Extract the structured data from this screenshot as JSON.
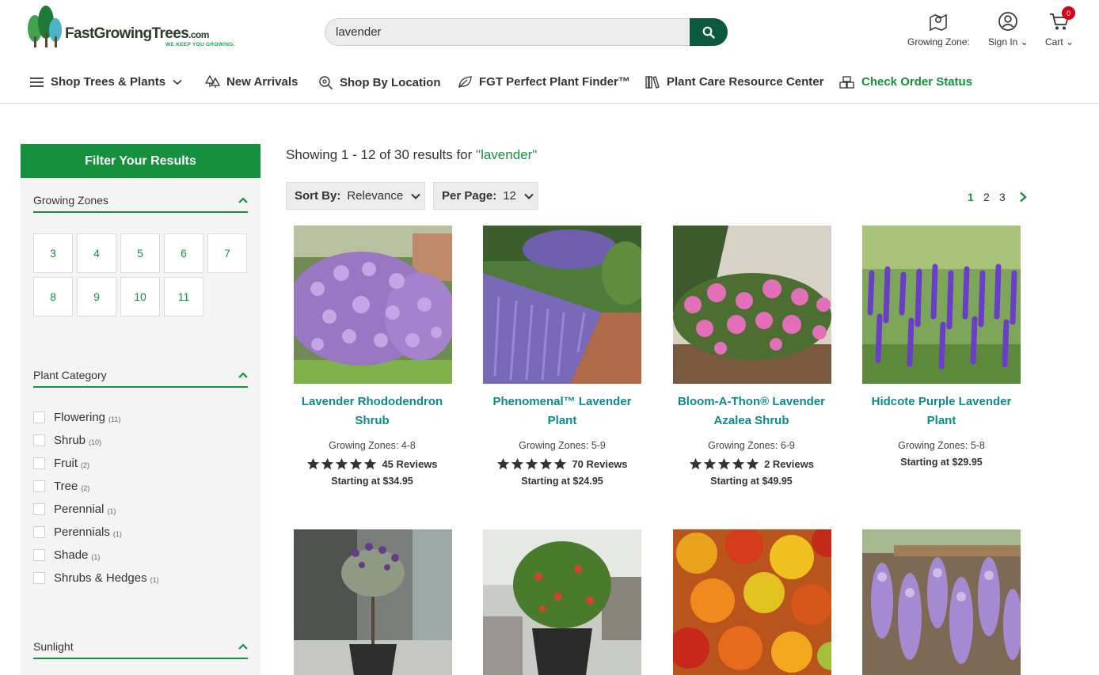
{
  "brand": {
    "name": "FastGrowingTrees",
    "suffix": ".com",
    "tagline": "WE KEEP YOU GROWING."
  },
  "search": {
    "value": "lavender",
    "placeholder": ""
  },
  "header": {
    "growing_zone_label": "Growing Zone:",
    "sign_in_label": "Sign In ⌄",
    "cart_label": "Cart ⌄",
    "cart_count": "0"
  },
  "nav": {
    "shop_trees": "Shop Trees & Plants",
    "new_arrivals": "New Arrivals",
    "shop_by_location": "Shop By Location",
    "plant_finder": "FGT Perfect Plant Finder™",
    "plant_care": "Plant Care Resource Center",
    "check_order": "Check Order Status"
  },
  "filters": {
    "heading": "Filter Your Results",
    "growing_zones": {
      "title": "Growing Zones",
      "zones": [
        "3",
        "4",
        "5",
        "6",
        "7",
        "8",
        "9",
        "10",
        "11"
      ]
    },
    "plant_category": {
      "title": "Plant Category",
      "items": [
        {
          "label": "Flowering",
          "count": "(11)"
        },
        {
          "label": "Shrub",
          "count": "(10)"
        },
        {
          "label": "Fruit",
          "count": "(2)"
        },
        {
          "label": "Tree",
          "count": "(2)"
        },
        {
          "label": "Perennial",
          "count": "(1)"
        },
        {
          "label": "Perennials",
          "count": "(1)"
        },
        {
          "label": "Shade",
          "count": "(1)"
        },
        {
          "label": "Shrubs & Hedges",
          "count": "(1)"
        }
      ]
    },
    "sunlight": {
      "title": "Sunlight"
    }
  },
  "results": {
    "prefix": "Showing 1 - 12 of 30 results for ",
    "term": "\"lavender\"",
    "sort_label": "Sort By:",
    "sort_value": "Relevance",
    "per_page_label": "Per Page:",
    "per_page_value": "12",
    "pages": [
      "1",
      "2",
      "3"
    ],
    "current_page": "1"
  },
  "products": [
    {
      "name_line1": "Lavender Rhododendron",
      "name_line2": "Shrub",
      "zones": "Growing Zones: 4-8",
      "reviews": "45 Reviews",
      "price": "Starting at $34.95",
      "stars": 5
    },
    {
      "name_line1": "Phenomenal™ Lavender",
      "name_line2": "Plant",
      "zones": "Growing Zones: 5-9",
      "reviews": "70 Reviews",
      "price": "Starting at $24.95",
      "stars": 5
    },
    {
      "name_line1": "Bloom-A-Thon® Lavender",
      "name_line2": "Azalea Shrub",
      "zones": "Growing Zones: 6-9",
      "reviews": "2 Reviews",
      "price": "Starting at $49.95",
      "stars": 5
    },
    {
      "name_line1": "Hidcote Purple Lavender",
      "name_line2": "Plant",
      "zones": "Growing Zones: 5-8",
      "reviews": "",
      "price": "Starting at $29.95",
      "stars": 0
    }
  ],
  "colors": {
    "brand_green": "#16903f",
    "dark_green": "#0c5a3e",
    "product_link": "#0e8a8a",
    "badge_red": "#d0021b"
  }
}
